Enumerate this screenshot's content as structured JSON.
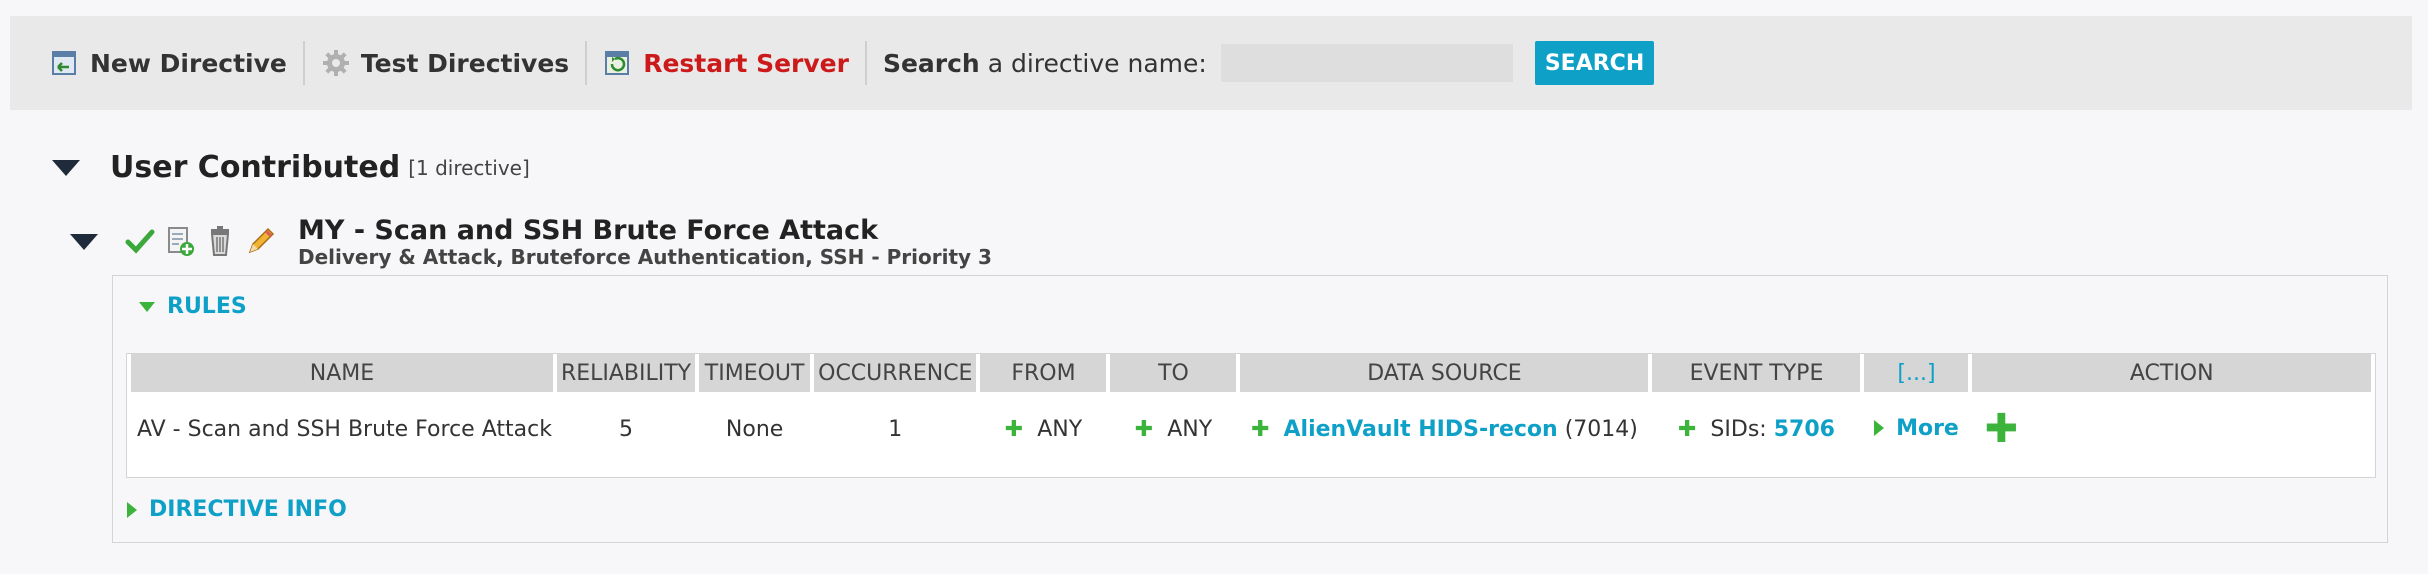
{
  "toolbar": {
    "new_directive": "New Directive",
    "test_directives": "Test Directives",
    "restart_server": "Restart Server",
    "search_bold": "Search",
    "search_rest": "a directive name:",
    "search_value": "",
    "search_button": "SEARCH"
  },
  "category": {
    "title": "User Contributed",
    "count": "[1 directive]"
  },
  "directive": {
    "title": "MY - Scan and SSH Brute Force Attack",
    "subtitle": "Delivery & Attack, Bruteforce Authentication, SSH - Priority 3"
  },
  "rules_section": {
    "label": "RULES"
  },
  "info_section": {
    "label": "DIRECTIVE INFO"
  },
  "table": {
    "headers": {
      "name": "NAME",
      "reliability": "RELIABILITY",
      "timeout": "TIMEOUT",
      "occurrence": "OCCURRENCE",
      "from": "FROM",
      "to": "TO",
      "data_source": "DATA SOURCE",
      "event_type": "EVENT TYPE",
      "more": "[...]",
      "action": "ACTION"
    },
    "rows": [
      {
        "name": "AV - Scan and SSH Brute Force Attack",
        "reliability": "5",
        "timeout": "None",
        "occurrence": "1",
        "from": "ANY",
        "to": "ANY",
        "data_source_link": "AlienVault HIDS-recon",
        "data_source_id": "(7014)",
        "sids_label": "SIDs:",
        "sids_value": "5706",
        "more_label": "More"
      }
    ]
  },
  "colors": {
    "accent": "#0fa0c8",
    "plus_green": "#3cb43c",
    "restart_red": "#cc1a1a"
  }
}
